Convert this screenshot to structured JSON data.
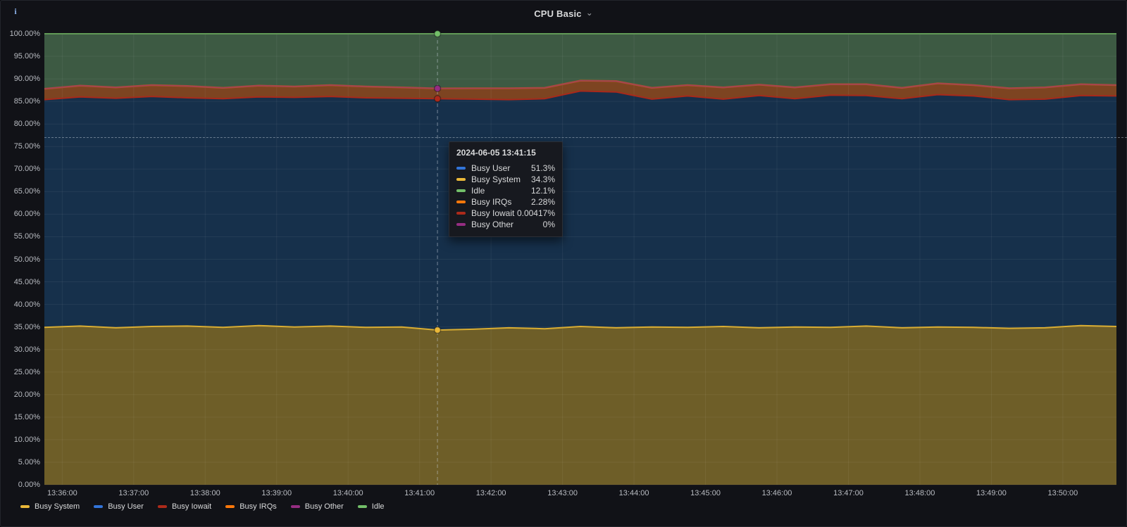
{
  "panel": {
    "title": "CPU Basic",
    "chevron": "⌄",
    "info_icon": "i"
  },
  "tooltip": {
    "timestamp": "2024-06-05 13:41:15",
    "rows": [
      {
        "label": "Busy User",
        "value": "51.3%",
        "color": "#3274d9"
      },
      {
        "label": "Busy System",
        "value": "34.3%",
        "color": "#eab839"
      },
      {
        "label": "Idle",
        "value": "12.1%",
        "color": "#73bf69"
      },
      {
        "label": "Busy IRQs",
        "value": "2.28%",
        "color": "#ff780a"
      },
      {
        "label": "Busy Iowait",
        "value": "0.00417%",
        "color": "#ad2a1a"
      },
      {
        "label": "Busy Other",
        "value": "0%",
        "color": "#962d82"
      }
    ]
  },
  "legend": [
    {
      "label": "Busy System",
      "color": "#eab839"
    },
    {
      "label": "Busy User",
      "color": "#3274d9"
    },
    {
      "label": "Busy Iowait",
      "color": "#ad2a1a"
    },
    {
      "label": "Busy IRQs",
      "color": "#ff780a"
    },
    {
      "label": "Busy Other",
      "color": "#962d82"
    },
    {
      "label": "Idle",
      "color": "#73bf69"
    }
  ],
  "chart_data": {
    "type": "area",
    "stacked": true,
    "title": "CPU Basic",
    "ylim": [
      0,
      100
    ],
    "grid": true,
    "legend_position": "bottom",
    "y_ticks": [
      "100.00%",
      "95.00%",
      "90.00%",
      "85.00%",
      "80.00%",
      "75.00%",
      "70.00%",
      "65.00%",
      "60.00%",
      "55.00%",
      "50.00%",
      "45.00%",
      "40.00%",
      "35.00%",
      "30.00%",
      "25.00%",
      "20.00%",
      "15.00%",
      "10.00%",
      "5.00%",
      "0.00%"
    ],
    "x_ticks": [
      "13:36:00",
      "13:37:00",
      "13:38:00",
      "13:39:00",
      "13:40:00",
      "13:41:00",
      "13:42:00",
      "13:43:00",
      "13:44:00",
      "13:45:00",
      "13:46:00",
      "13:47:00",
      "13:48:00",
      "13:49:00",
      "13:50:00"
    ],
    "x": [
      "13:35:45",
      "13:36:15",
      "13:36:45",
      "13:37:15",
      "13:37:45",
      "13:38:15",
      "13:38:45",
      "13:39:15",
      "13:39:45",
      "13:40:15",
      "13:40:45",
      "13:41:15",
      "13:41:45",
      "13:42:15",
      "13:42:45",
      "13:43:15",
      "13:43:45",
      "13:44:15",
      "13:44:45",
      "13:45:15",
      "13:45:45",
      "13:46:15",
      "13:46:45",
      "13:47:15",
      "13:47:45",
      "13:48:15",
      "13:48:45",
      "13:49:15",
      "13:49:45",
      "13:50:15",
      "13:50:45"
    ],
    "series": [
      {
        "name": "Busy System",
        "line": "#d9ad33",
        "fill": "#6e5e28",
        "values": [
          34.9,
          35.2,
          34.8,
          35.1,
          35.2,
          34.9,
          35.3,
          35.0,
          35.2,
          34.9,
          35.0,
          34.3,
          34.5,
          34.8,
          34.6,
          35.1,
          34.8,
          35.0,
          34.9,
          35.1,
          34.8,
          35.0,
          34.9,
          35.2,
          34.8,
          35.0,
          34.9,
          34.7,
          34.8,
          35.3,
          35.1
        ]
      },
      {
        "name": "Busy User",
        "line": "#3274d9",
        "fill": "#16304b",
        "values": [
          50.5,
          50.8,
          50.9,
          51.0,
          50.6,
          50.7,
          50.7,
          50.9,
          50.9,
          50.9,
          50.7,
          51.3,
          51.0,
          50.6,
          51.0,
          52.2,
          52.3,
          50.5,
          51.3,
          50.4,
          51.5,
          50.6,
          51.5,
          51.1,
          50.8,
          51.5,
          51.3,
          50.7,
          50.7,
          51.0,
          51.1
        ]
      },
      {
        "name": "Busy Iowait",
        "line": "#a8291b",
        "fill": "none",
        "values": [
          0.004,
          0.004,
          0.004,
          0.004,
          0.004,
          0.004,
          0.004,
          0.004,
          0.004,
          0.004,
          0.004,
          0.00417,
          0.004,
          0.004,
          0.004,
          0.004,
          0.004,
          0.004,
          0.004,
          0.004,
          0.004,
          0.004,
          0.004,
          0.004,
          0.004,
          0.004,
          0.004,
          0.004,
          0.004,
          0.004,
          0.004
        ]
      },
      {
        "name": "Busy IRQs",
        "line": "#b4591f",
        "fill": "#7d4421",
        "values": [
          2.4,
          2.5,
          2.4,
          2.5,
          2.6,
          2.4,
          2.5,
          2.4,
          2.5,
          2.5,
          2.4,
          2.28,
          2.4,
          2.5,
          2.4,
          2.3,
          2.4,
          2.5,
          2.4,
          2.6,
          2.4,
          2.5,
          2.4,
          2.5,
          2.4,
          2.5,
          2.4,
          2.5,
          2.6,
          2.5,
          2.4
        ]
      },
      {
        "name": "Busy Other",
        "line": "#962d82",
        "fill": "none",
        "values": [
          0,
          0,
          0,
          0,
          0,
          0,
          0,
          0,
          0,
          0,
          0,
          0,
          0,
          0,
          0,
          0,
          0,
          0,
          0,
          0,
          0,
          0,
          0,
          0,
          0,
          0,
          0,
          0,
          0,
          0,
          0
        ]
      },
      {
        "name": "Idle",
        "line": "#619a57",
        "fill": "#3d5a43",
        "values": [
          12.2,
          11.5,
          11.9,
          11.4,
          11.6,
          12.0,
          11.5,
          11.7,
          11.4,
          11.7,
          11.9,
          12.1,
          12.1,
          12.1,
          12.0,
          10.4,
          10.5,
          12.0,
          11.4,
          11.9,
          11.3,
          11.9,
          11.2,
          11.2,
          12.0,
          11.0,
          11.4,
          12.1,
          11.9,
          11.2,
          11.4
        ]
      }
    ],
    "crosshair": {
      "time": "13:41:15",
      "x_index": 11,
      "h_line_percent": 77,
      "points": [
        {
          "percent": 100.0,
          "color": "#73bf69"
        },
        {
          "percent": 87.88,
          "color": "#962d82"
        },
        {
          "percent": 85.6,
          "color": "#ad2a1a"
        },
        {
          "percent": 34.3,
          "color": "#eab839"
        }
      ]
    }
  }
}
